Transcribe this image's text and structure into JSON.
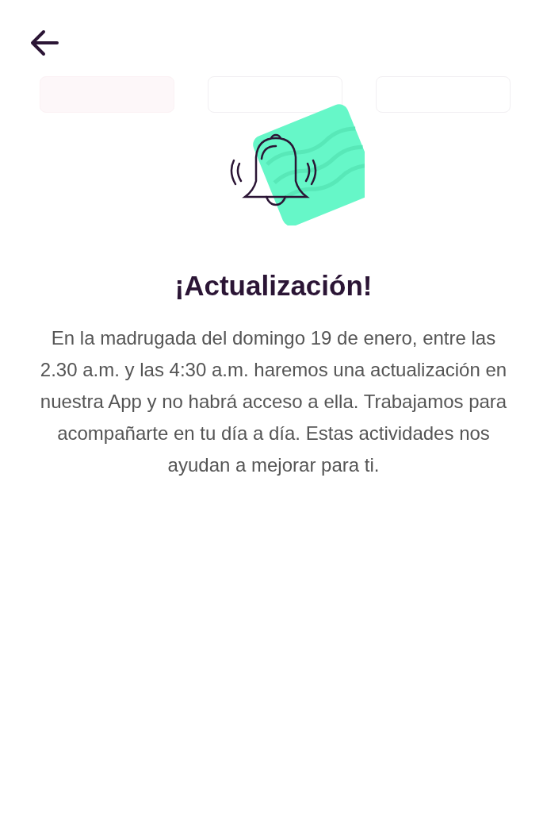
{
  "dialog": {
    "title": "¡Actualización!",
    "message": "En la madrugada del domingo 19 de enero, entre las 2.30 a.m. y las 4:30 a.m. haremos una actualización en nuestra App y no habrá acceso a ella. Trabajamos para acompañarte en tu día a día. Estas actividades nos ayudan a mejorar para ti."
  }
}
